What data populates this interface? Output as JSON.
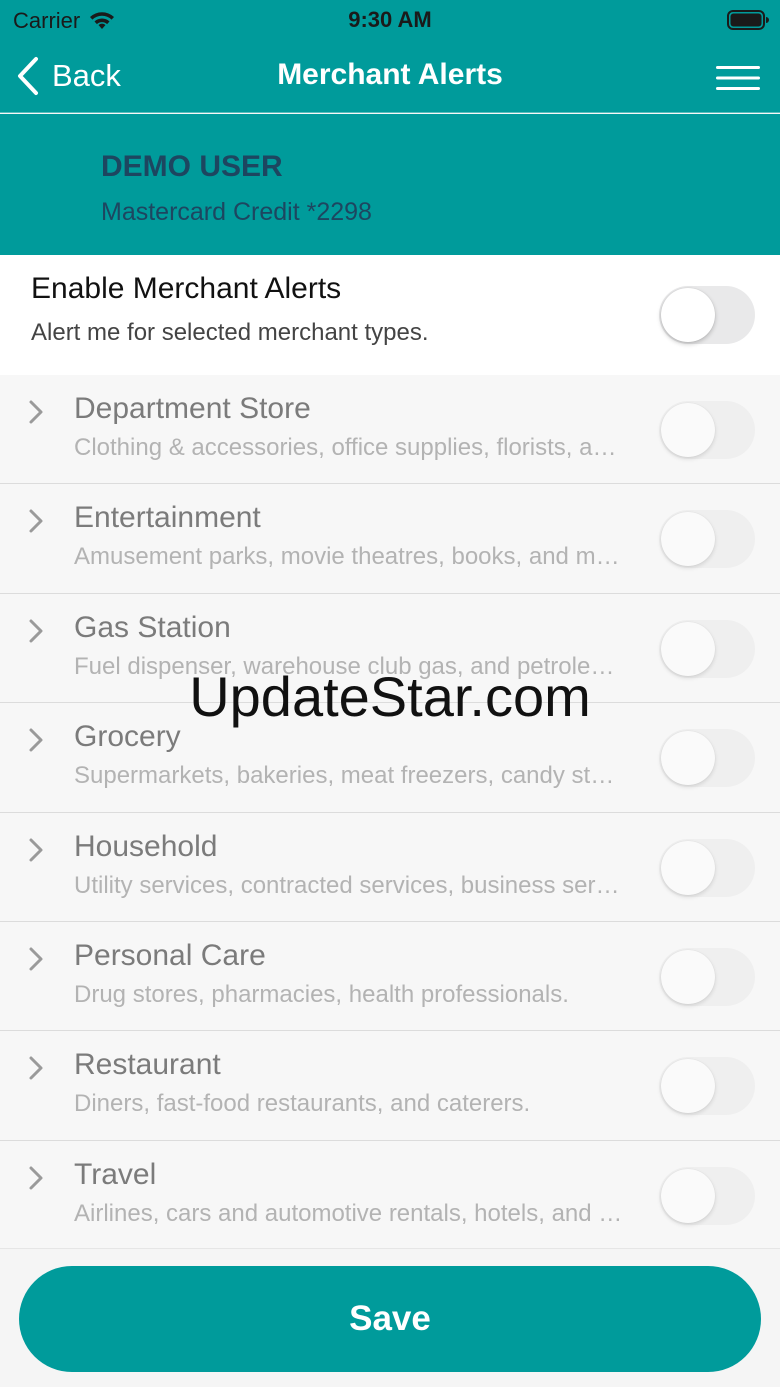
{
  "status_bar": {
    "carrier": "Carrier",
    "time": "9:30 AM"
  },
  "nav": {
    "back_label": "Back",
    "title": "Merchant Alerts"
  },
  "account": {
    "name": "DEMO USER",
    "card": "Mastercard Credit *2298"
  },
  "enable": {
    "title": "Enable Merchant Alerts",
    "subtitle": "Alert me for selected merchant types.",
    "enabled": false
  },
  "categories": [
    {
      "name": "Department Store",
      "description": "Clothing & accessories, office supplies, florists, and more.",
      "enabled": false
    },
    {
      "name": "Entertainment",
      "description": "Amusement parks, movie theatres, books, and more.",
      "enabled": false
    },
    {
      "name": "Gas Station",
      "description": "Fuel dispenser, warehouse club gas, and petroleum.",
      "enabled": false
    },
    {
      "name": "Grocery",
      "description": "Supermarkets, bakeries, meat freezers, candy stores.",
      "enabled": false
    },
    {
      "name": "Household",
      "description": "Utility services, contracted services, business services.",
      "enabled": false
    },
    {
      "name": "Personal Care",
      "description": "Drug stores, pharmacies, health professionals.",
      "enabled": false
    },
    {
      "name": "Restaurant",
      "description": "Diners, fast-food restaurants, and caterers.",
      "enabled": false
    },
    {
      "name": "Travel",
      "description": "Airlines, cars and automotive rentals, hotels, and more.",
      "enabled": false
    }
  ],
  "watermark": "UpdateStar.com",
  "save_label": "Save",
  "colors": {
    "primary": "#009b9b",
    "account_text": "#1d4660"
  }
}
